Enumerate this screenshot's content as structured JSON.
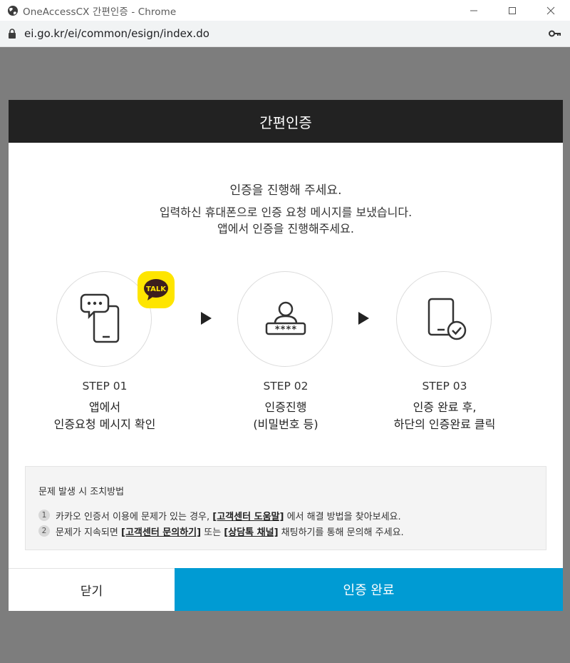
{
  "window": {
    "title": "OneAccessCX 간편인증 - Chrome",
    "url": "ei.go.kr/ei/common/esign/index.do"
  },
  "modal": {
    "header": "간편인증",
    "message_main": "인증을 진행해 주세요.",
    "message_line1": "입력하신 휴대폰으로 인증 요청 메시지를 보냈습니다.",
    "message_line2": "앱에서 인증을 진행해주세요.",
    "talk_badge": "TALK",
    "steps": [
      {
        "title": "STEP 01",
        "desc_line1": "앱에서",
        "desc_line2": "인증요청 메시지 확인",
        "icon": "phone-chat-icon"
      },
      {
        "title": "STEP 02",
        "desc_line1": "인증진행",
        "desc_line2": "(비밀번호 등)",
        "icon": "user-password-icon"
      },
      {
        "title": "STEP 03",
        "desc_line1": "인증 완료 후,",
        "desc_line2": "하단의 인증완료 클릭",
        "icon": "phone-check-icon"
      }
    ],
    "password_mask": "****",
    "help": {
      "title": "문제 발생 시 조치방법",
      "items": [
        {
          "num": "1",
          "pre": "카카오 인증서 이용에 문제가 있는 경우,",
          "link1": "[고객센터 도움말]",
          "mid": "에서 해결 방법을 찾아보세요.",
          "link2": "",
          "post": ""
        },
        {
          "num": "2",
          "pre": "문제가 지속되면",
          "link1": "[고객센터 문의하기]",
          "mid": "또는",
          "link2": "[상담톡 채널]",
          "post": "채팅하기를 통해 문의해 주세요."
        }
      ]
    },
    "buttons": {
      "close": "닫기",
      "complete": "인증 완료"
    }
  },
  "colors": {
    "header_bg": "#222222",
    "primary_button": "#009bd3",
    "kakao_yellow": "#fee500",
    "overlay": "#7d7d7d"
  }
}
